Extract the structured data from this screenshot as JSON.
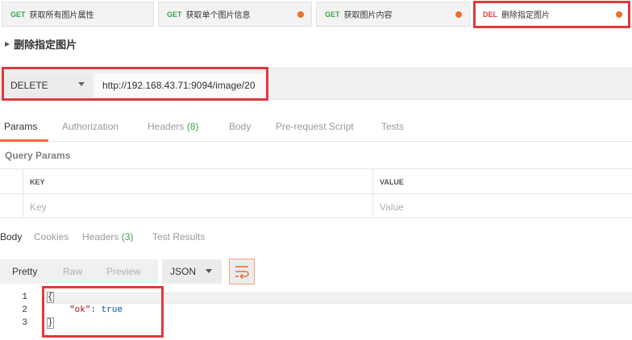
{
  "tabs": [
    {
      "method": "GET",
      "name": "获取所有图片属性",
      "unsaved": false
    },
    {
      "method": "GET",
      "name": "获取单个图片信息",
      "unsaved": true
    },
    {
      "method": "GET",
      "name": "获取图片内容",
      "unsaved": true
    },
    {
      "method": "DEL",
      "name": "删除指定图片",
      "unsaved": true
    }
  ],
  "request": {
    "title": "删除指定图片",
    "method": "DELETE",
    "url": "http://192.168.43.71:9094/image/20"
  },
  "request_tabs": {
    "params": "Params",
    "authorization": "Authorization",
    "headers": "Headers",
    "headers_count": "(8)",
    "body": "Body",
    "prerequest": "Pre-request Script",
    "tests": "Tests"
  },
  "query_params": {
    "label": "Query Params",
    "key_header": "KEY",
    "value_header": "VALUE",
    "key_placeholder": "Key",
    "value_placeholder": "Value"
  },
  "response_tabs": {
    "body": "Body",
    "cookies": "Cookies",
    "headers": "Headers",
    "headers_count": "(3)",
    "test_results": "Test Results"
  },
  "response_toolbar": {
    "pretty": "Pretty",
    "raw": "Raw",
    "preview": "Preview",
    "format": "JSON"
  },
  "response_body": {
    "line_numbers": [
      "1",
      "2",
      "3"
    ],
    "open": "{",
    "key": "\"ok\"",
    "colon": ": ",
    "value": "true",
    "close": "}"
  },
  "colors": {
    "accent": "#f26b3a",
    "get": "#3ea54d",
    "delete": "#ea3b3b",
    "highlight_box": "#e0393e"
  }
}
